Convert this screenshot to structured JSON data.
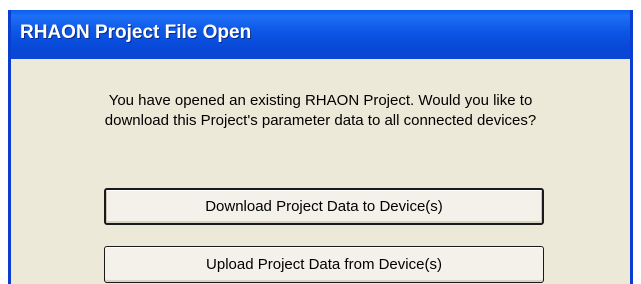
{
  "dialog": {
    "title": "RHAON Project File Open",
    "message_line1": "You have opened an existing RHAON Project. Would you like to",
    "message_line2": "download this Project's parameter data to all connected devices?",
    "buttons": {
      "download_label": "Download Project Data to Device(s)",
      "upload_label": "Upload Project Data from Device(s)"
    }
  },
  "colors": {
    "titlebar": "#0a52e0",
    "dialog_face": "#ece9d8",
    "button_face": "#f3f1ea"
  }
}
